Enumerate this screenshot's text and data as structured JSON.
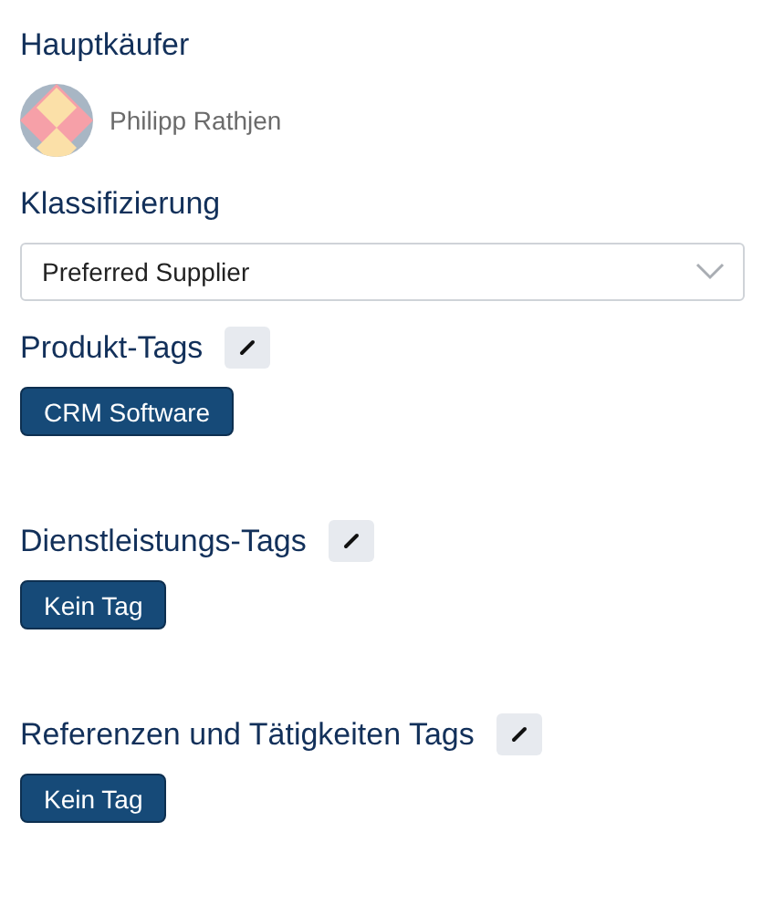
{
  "buyer": {
    "label": "Hauptkäufer",
    "name": "Philipp Rathjen"
  },
  "classification": {
    "label": "Klassifizierung",
    "value": "Preferred Supplier"
  },
  "tag_groups": [
    {
      "label": "Produkt-Tags",
      "tags": [
        "CRM Software"
      ]
    },
    {
      "label": "Dienstleistungs-Tags",
      "tags": [
        "Kein Tag"
      ]
    },
    {
      "label": "Referenzen und Tätigkeiten Tags",
      "tags": [
        "Kein Tag"
      ]
    }
  ]
}
